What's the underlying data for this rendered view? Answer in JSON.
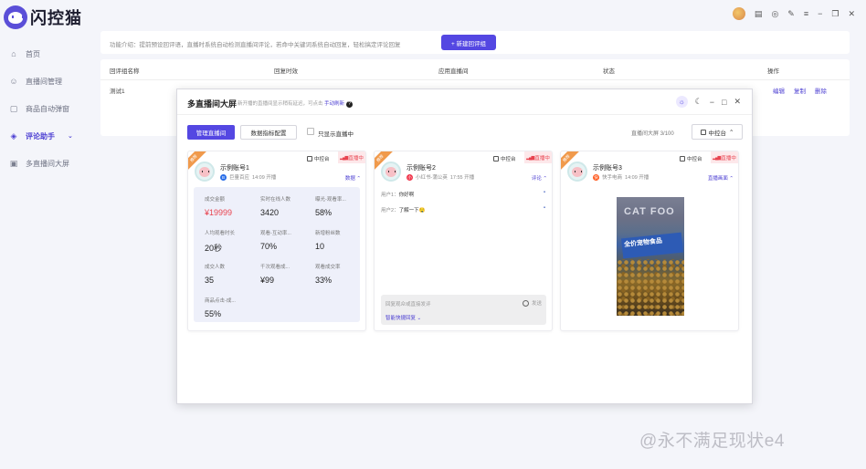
{
  "app": {
    "name": "闪控猫"
  },
  "sidebar": {
    "items": [
      {
        "label": "首页",
        "icon": "home-icon"
      },
      {
        "label": "直播间管理",
        "icon": "users-icon"
      },
      {
        "label": "商品自动弹窗",
        "icon": "product-icon"
      },
      {
        "label": "评论助手",
        "icon": "box-icon",
        "active": true
      },
      {
        "label": "多直播间大屏",
        "icon": "screen-icon"
      }
    ]
  },
  "topbar": {
    "icons": [
      "avatar",
      "clipboard-icon",
      "headset-icon",
      "edit-icon",
      "menu-icon",
      "minimize-icon",
      "restore-icon",
      "close-icon"
    ]
  },
  "intro": {
    "text": "功能介绍：提前预设回评语，直播时系统自动检测直播间评论，若命中关键词系统自动回复，轻松搞定评论回复",
    "new_button": "+ 新建回评组"
  },
  "table": {
    "headers": [
      "回评组名称",
      "回复时效",
      "应用直播间",
      "状态",
      "操作"
    ],
    "rows": [
      {
        "name": "测试1",
        "actions": [
          "编辑",
          "复制",
          "删除"
        ]
      }
    ]
  },
  "modal": {
    "title": "多直播间大屏",
    "subtitle": "新开播的直播间显示稍有延迟，可点击",
    "refresh_link": "手动刷新",
    "manage_button": "管理直播间",
    "metrics_button": "数据指标配置",
    "only_live_label": "只显示直播中",
    "count_label": "直播间大屏",
    "count_value": "3/100",
    "console_button": "中控台",
    "cards": [
      {
        "ribbon": "推荐",
        "console": "中控台",
        "live": "直播中",
        "name": "示例账号1",
        "platform": "巨量百应",
        "time": "14:09 开播",
        "toggle": "数据",
        "stats": [
          {
            "label": "成交金额",
            "value": "¥19999",
            "red": true
          },
          {
            "label": "实时在线人数",
            "value": "3420"
          },
          {
            "label": "曝光-观看率...",
            "value": "58%"
          },
          {
            "label": "人均观看时长",
            "value": "20秒"
          },
          {
            "label": "观看-互动率...",
            "value": "70%"
          },
          {
            "label": "新增粉丝数",
            "value": "10"
          },
          {
            "label": "成交人数",
            "value": "35"
          },
          {
            "label": "千次观看成...",
            "value": "¥99"
          },
          {
            "label": "观看成交率",
            "value": "33%"
          },
          {
            "label": "商品点击-成...",
            "value": "55%"
          }
        ]
      },
      {
        "ribbon": "推荐",
        "console": "中控台",
        "live": "直播中",
        "name": "示例账号2",
        "platform": "小红书-蒲公英",
        "time": "17:55 开播",
        "toggle": "评论",
        "comments": [
          {
            "user": "用户1：",
            "text": "你好啊"
          },
          {
            "user": "用户2：",
            "text": "了解一下🤤"
          }
        ],
        "reply_placeholder": "回复观众或直接发评",
        "send": "发送",
        "quick_reply": "智能快捷回复"
      },
      {
        "ribbon": "推荐",
        "console": "中控台",
        "live": "直播中",
        "name": "示例账号3",
        "platform": "快手电商",
        "time": "14:09 开播",
        "toggle": "直播画面",
        "image_text_top": "CAT FOO",
        "image_text_label": "全价宠物食品"
      }
    ]
  },
  "watermark": "@永不满足现状e4",
  "colors": {
    "accent": "#5447e2",
    "live_red": "#e8434f",
    "ribbon": "#f09a4c"
  }
}
